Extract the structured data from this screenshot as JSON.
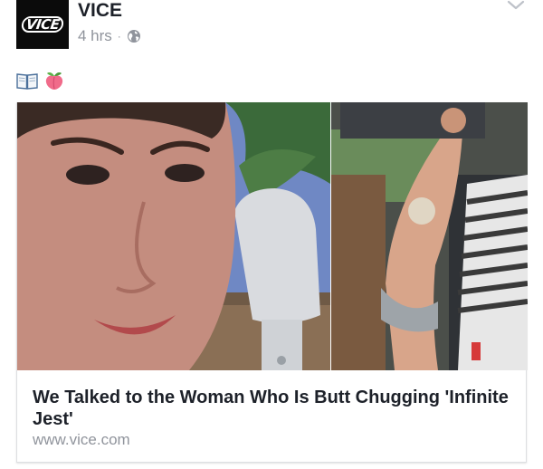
{
  "post": {
    "page_name": "VICE",
    "avatar_text": "VICE",
    "time": "4 hrs",
    "separator": "·",
    "privacy_icon": "globe-icon",
    "menu_icon": "chevron-down-icon"
  },
  "message": {
    "emojis": [
      "open-book-icon",
      "peach-icon"
    ]
  },
  "link_card": {
    "title": "We Talked to the Woman Who Is Butt Chugging 'Infinite Jest'",
    "domain": "www.vice.com"
  },
  "colors": {
    "text_primary": "#1d2129",
    "text_secondary": "#90949c",
    "card_border": "#dddfe2"
  }
}
